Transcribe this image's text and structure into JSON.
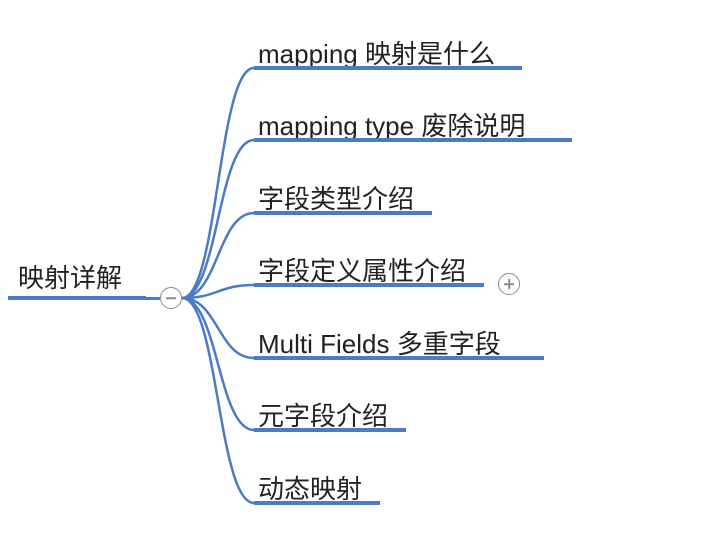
{
  "root": {
    "label": "映射详解"
  },
  "children": [
    {
      "label": "mapping 映射是什么",
      "has_children": false
    },
    {
      "label": "mapping type 废除说明",
      "has_children": false
    },
    {
      "label": "字段类型介绍",
      "has_children": false
    },
    {
      "label": "字段定义属性介绍",
      "has_children": true
    },
    {
      "label": "Multi Fields 多重字段",
      "has_children": false
    },
    {
      "label": "元字段介绍",
      "has_children": false
    },
    {
      "label": "动态映射",
      "has_children": false
    }
  ],
  "colors": {
    "line": "#4a7bc4"
  }
}
